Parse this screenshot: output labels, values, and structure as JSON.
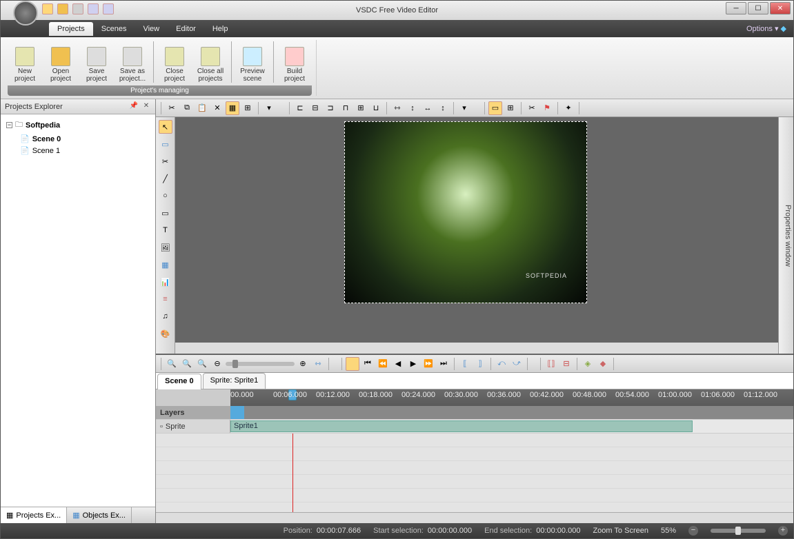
{
  "app_title": "VSDC Free Video Editor",
  "watermark": "SOFTPEDIA",
  "menus": [
    "Projects",
    "Scenes",
    "View",
    "Editor",
    "Help"
  ],
  "active_menu": 0,
  "options_label": "Options",
  "ribbon": {
    "group_title": "Project's managing",
    "buttons": [
      {
        "label": "New project"
      },
      {
        "label": "Open project"
      },
      {
        "label": "Save project"
      },
      {
        "label": "Save as project..."
      },
      {
        "label": "Close project"
      },
      {
        "label": "Close all projects"
      },
      {
        "label": "Preview scene"
      },
      {
        "label": "Build project"
      }
    ]
  },
  "left_panel": {
    "title": "Projects Explorer",
    "project_name": "Softpedia",
    "scenes": [
      "Scene 0",
      "Scene 1"
    ],
    "selected_scene": 0,
    "tabs": [
      "Projects Ex...",
      "Objects Ex..."
    ]
  },
  "right_panel_tab": "Properties window",
  "preview_watermark": "SOFTPEDIA",
  "timeline": {
    "tabs": [
      "Scene 0",
      "Sprite: Sprite1"
    ],
    "active_tab": 0,
    "layers_label": "Layers",
    "layer_name": "Sprite",
    "clip_name": "Sprite1",
    "ticks": [
      "00.000",
      "00:06.000",
      "00:12.000",
      "00:18.000",
      "00:24.000",
      "00:30.000",
      "00:36.000",
      "00:42.000",
      "00:48.000",
      "00:54.000",
      "01:00.000",
      "01:06.000",
      "01:12.000"
    ]
  },
  "statusbar": {
    "position_label": "Position:",
    "position": "00:00:07.666",
    "start_sel_label": "Start selection:",
    "start_sel": "00:00:00.000",
    "end_sel_label": "End selection:",
    "end_sel": "00:00:00.000",
    "zoom_label": "Zoom To Screen",
    "zoom_pct": "55%"
  },
  "vertical_tools": [
    "cursor",
    "rect-select",
    "crop",
    "line",
    "ellipse",
    "rect",
    "text",
    "image",
    "video",
    "chart",
    "subtitle",
    "audio",
    "spray"
  ],
  "tl_transport": [
    "play",
    "prev-marker",
    "step-back",
    "frame-back",
    "frame-fwd",
    "step-fwd",
    "next-marker",
    "mark-in",
    "mark-out",
    "loop-back",
    "loop-fwd"
  ]
}
